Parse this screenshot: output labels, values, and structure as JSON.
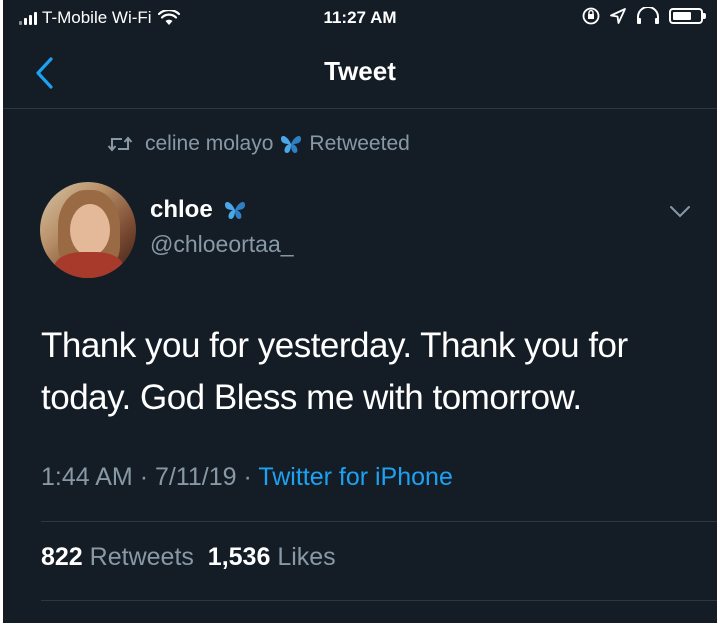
{
  "status_bar": {
    "carrier": "T-Mobile Wi-Fi",
    "time": "11:27 AM"
  },
  "nav": {
    "title": "Tweet",
    "back_icon": "chevron-left-icon"
  },
  "retweet": {
    "user": "celine molayo",
    "label": "Retweeted",
    "icon": "retweet-icon"
  },
  "tweet": {
    "author_name": "chloe",
    "handle": "@chloeortaa_",
    "text": "Thank you for yesterday. Thank you for today. God Bless me with tomorrow.",
    "time": "1:44 AM",
    "date": "7/11/19",
    "source": "Twitter for iPhone",
    "separator": "·"
  },
  "stats": {
    "retweets_count": "822",
    "retweets_label": "Retweets",
    "likes_count": "1,536",
    "likes_label": "Likes"
  },
  "colors": {
    "background": "#141d26",
    "accent": "#1da1f2",
    "secondary_text": "#8899a6",
    "butterfly": "#4aa8e8"
  }
}
